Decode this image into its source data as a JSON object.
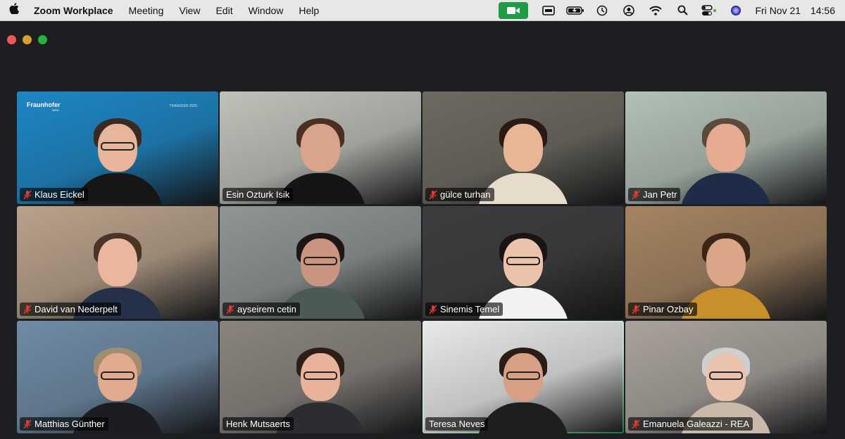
{
  "menubar": {
    "app_name": "Zoom Workplace",
    "items": [
      "Meeting",
      "View",
      "Edit",
      "Window",
      "Help"
    ],
    "status_icons": [
      "screen-mirror-icon",
      "battery-icon",
      "time-machine-icon",
      "user-icon",
      "wifi-icon",
      "search-icon",
      "control-center-icon",
      "siri-icon"
    ],
    "day": "Fri Nov 21",
    "time": "14:56"
  },
  "colors": {
    "accent_green": "#2fb34c",
    "mute_red": "#e53935",
    "window_bg": "#1d1e21"
  },
  "participants": [
    {
      "name": "Klaus Eickel",
      "muted": true,
      "bg": "#1d86c4",
      "shirt": "#161616",
      "hair": "#3a2a22",
      "skin": "#e8b59b",
      "glasses": true,
      "logo": "Fraunhofer",
      "logo_sub": "IMEB",
      "banner": "TRANSFER 2025"
    },
    {
      "name": "Esin Ozturk Isik",
      "muted": false,
      "bg": "#bfc2b9",
      "shirt": "#151515",
      "hair": "#4b2f22",
      "skin": "#d9a58a",
      "glasses": false
    },
    {
      "name": "gülce turhan",
      "muted": true,
      "bg": "#6d6a60",
      "shirt": "#e7dccb",
      "hair": "#2a1a14",
      "skin": "#e7b795",
      "glasses": false
    },
    {
      "name": "Jan Petr",
      "muted": true,
      "bg": "#b3c1b7",
      "shirt": "#1e2c4a",
      "hair": "#5b4a3a",
      "skin": "#e6ac92",
      "glasses": false
    },
    {
      "name": "David van Nederpelt",
      "muted": true,
      "bg": "#b9a28a",
      "shirt": "#243149",
      "hair": "#4a3428",
      "skin": "#eab69d",
      "glasses": false
    },
    {
      "name": "ayseirem cetin",
      "muted": true,
      "bg": "#8f9694",
      "shirt": "#4c5a54",
      "hair": "#1f1512",
      "skin": "#c99580",
      "glasses": true
    },
    {
      "name": "Sinemis Temel",
      "muted": true,
      "bg": "#3b3d3e",
      "shirt": "#f2f2f2",
      "hair": "#1b1412",
      "skin": "#ebc2aa",
      "glasses": true
    },
    {
      "name": "Pinar Ozbay",
      "muted": true,
      "bg": "#a58461",
      "shirt": "#c98f2a",
      "hair": "#3a2517",
      "skin": "#dba589",
      "glasses": false
    },
    {
      "name": "Matthias Günther",
      "muted": true,
      "bg": "#6f8ba5",
      "shirt": "#1c1d22",
      "hair": "#a58c6d",
      "skin": "#e2ab90",
      "glasses": true
    },
    {
      "name": "Henk Mutsaerts",
      "muted": false,
      "bg": "#8a847d",
      "shirt": "#2b2d33",
      "hair": "#2d1e17",
      "skin": "#e8b39a",
      "glasses": true
    },
    {
      "name": "Teresa Neves",
      "muted": false,
      "bg": "#e8e9e9",
      "shirt": "#1e1e1e",
      "hair": "#2a1d18",
      "skin": "#d7a084",
      "glasses": true,
      "active": true
    },
    {
      "name": "Emanuela Galeazzi - REA",
      "muted": true,
      "bg": "#aaa39c",
      "shirt": "#c9b9ab",
      "hair": "#cfcfcf",
      "skin": "#ebc3ad",
      "glasses": true
    }
  ]
}
